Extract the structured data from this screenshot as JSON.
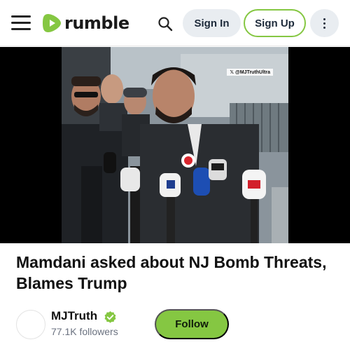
{
  "header": {
    "logo_text": "rumble",
    "sign_in_label": "Sign In",
    "sign_up_label": "Sign Up",
    "icons": {
      "menu": "hamburger-menu-icon",
      "search": "search-icon",
      "more": "vertical-dots-icon"
    }
  },
  "video": {
    "watermark": "@MJTruthUltra"
  },
  "main": {
    "title": "Mamdani asked about NJ Bomb Threats, Blames Trump"
  },
  "channel": {
    "name": "MJTruth",
    "followers": "77.1K followers",
    "follow_label": "Follow",
    "verified": true
  },
  "colors": {
    "brand_green": "#85c742",
    "pill_gray": "#e9edf1",
    "text_dark": "#111111",
    "muted_text": "#6b7280"
  }
}
